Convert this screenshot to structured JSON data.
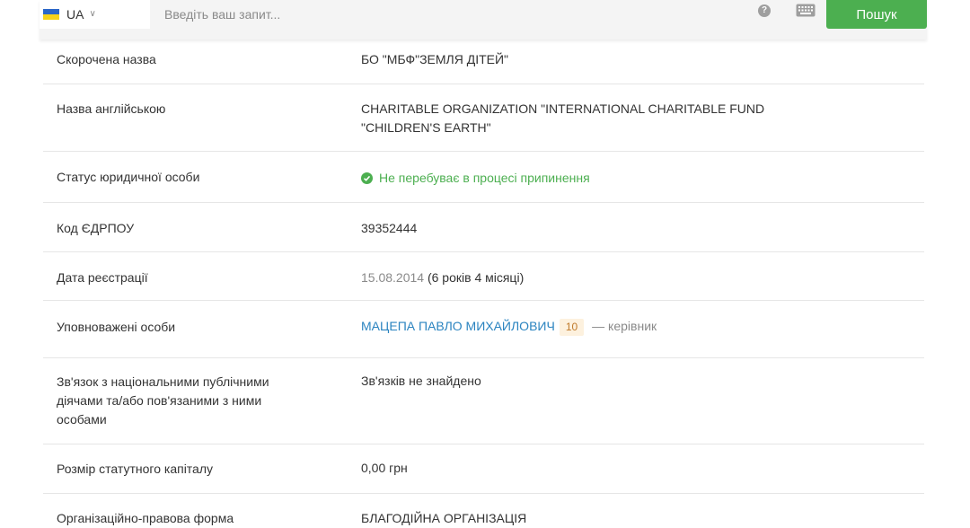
{
  "header": {
    "lang_code": "UA",
    "search_placeholder": "Введіть ваш запит...",
    "help_glyph": "?",
    "search_button": "Пошук"
  },
  "rows": [
    {
      "label": "Скорочена назва",
      "value": "БО \"МБФ\"ЗЕМЛЯ ДІТЕЙ\""
    },
    {
      "label": "Назва англійською",
      "value": "CHARITABLE ORGANIZATION \"INTERNATIONAL CHARITABLE FUND \"CHILDREN'S EARTH\""
    },
    {
      "label": "Статус юридичної особи",
      "value": "Не перебуває в процесі припинення"
    },
    {
      "label": "Код ЄДРПОУ",
      "value": "39352444"
    },
    {
      "label": "Дата реєстрації",
      "date": "15.08.2014",
      "duration": "(6 років 4 місяці)"
    },
    {
      "label": "Уповноважені особи",
      "person": "МАЦЕПА ПАВЛО МИХАЙЛОВИЧ",
      "count": "10",
      "role": "— керівник"
    },
    {
      "label": "Зв'язок з національними публічними діячами та/або пов'язаними з ними особами",
      "value": "Зв'язків не знайдено"
    },
    {
      "label": "Розмір статутного капіталу",
      "value": "0,00 грн"
    },
    {
      "label": "Організаційно-правова форма",
      "value": "БЛАГОДІЙНА ОРГАНІЗАЦІЯ"
    }
  ],
  "colors": {
    "accent_green": "#4caf50",
    "link_blue": "#2b84c0",
    "badge_bg": "#fdf1de"
  }
}
